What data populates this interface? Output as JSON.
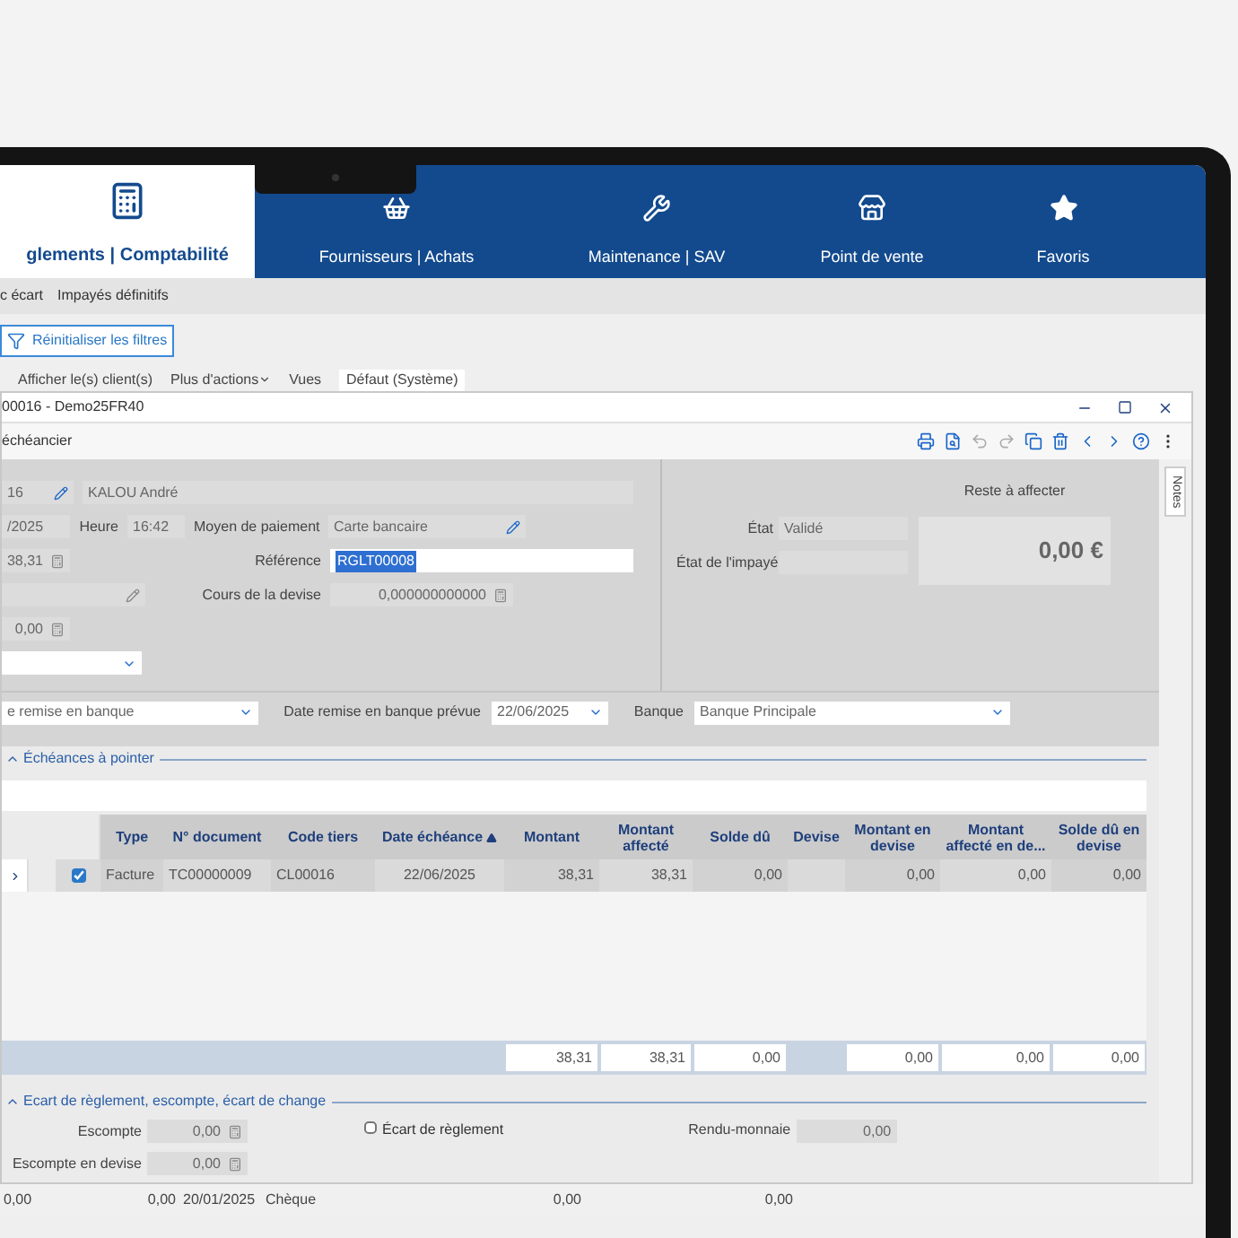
{
  "nav_tabs": [
    {
      "label": "glements | Comptabilité",
      "selected": true
    },
    {
      "label": "Fournisseurs | Achats",
      "selected": false
    },
    {
      "label": "Maintenance | SAV",
      "selected": false
    },
    {
      "label": "Point de vente",
      "selected": false
    },
    {
      "label": "Favoris",
      "selected": false
    }
  ],
  "sub_menu": [
    "c écart",
    "Impayés définitifs"
  ],
  "filter_button": "Réinitialiser les filtres",
  "toolbar": {
    "show_clients": "Afficher le(s) client(s)",
    "more_actions": "Plus d'actions",
    "views_label": "Vues",
    "view_value": "Défaut (Système)"
  },
  "dialog": {
    "title": "00016 - Demo25FR40",
    "toolbar_label": "échéancier",
    "notes_tab": "Notes",
    "form": {
      "client_code": "16",
      "client_name": "KALOU André",
      "date": "/2025",
      "time_label": "Heure",
      "time": "16:42",
      "payment_label": "Moyen de paiement",
      "payment": "Carte bancaire",
      "amount": "38,31",
      "reference_label": "Référence",
      "reference": "RGLT00008",
      "rate_label": "Cours de la devise",
      "rate": "0,000000000000",
      "amount2": "0,00",
      "remaining_label": "Reste à affecter",
      "remaining": "0,00 €",
      "status_label": "État",
      "status": "Validé",
      "unpaid_label": "État de l'impayé",
      "bank_remit": "e remise en banque",
      "remit_date_label": "Date remise en banque prévue",
      "remit_date": "22/06/2025",
      "bank_label": "Banque",
      "bank": "Banque Principale"
    },
    "schedule": {
      "title": "Échéances à pointer",
      "expanded": true,
      "columns": [
        {
          "label": "Type"
        },
        {
          "label": "N° document"
        },
        {
          "label": "Code tiers"
        },
        {
          "label": "Date échéance",
          "sorted": true
        },
        {
          "label": "Montant"
        },
        {
          "label": "Montant affecté"
        },
        {
          "label": "Solde dû"
        },
        {
          "label": "Devise"
        },
        {
          "label": "Montant en devise"
        },
        {
          "label": "Montant affecté en de..."
        },
        {
          "label": "Solde dû en devise"
        }
      ],
      "rows": [
        {
          "checked": true,
          "cells": [
            "Facture",
            "TC00000009",
            "CL00016",
            "22/06/2025",
            "38,31",
            "38,31",
            "0,00",
            "",
            "0,00",
            "0,00",
            "0,00"
          ]
        }
      ],
      "totals": [
        "38,31",
        "38,31",
        "0,00",
        "0,00",
        "0,00",
        "0,00"
      ]
    },
    "gap_section": {
      "title": "Ecart de règlement, escompte, écart de change",
      "expanded": true,
      "discount_label": "Escompte",
      "discount": "0,00",
      "discount_currency_label": "Escompte en devise",
      "discount_currency": "0,00",
      "gap_checkbox": {
        "label": "Écart de règlement",
        "checked": false
      },
      "change_label": "Rendu-monnaie",
      "change": "0,00"
    }
  },
  "background_row": [
    "0,00",
    "0,00",
    "20/01/2025",
    "Chèque",
    "0,00",
    "0,00"
  ]
}
